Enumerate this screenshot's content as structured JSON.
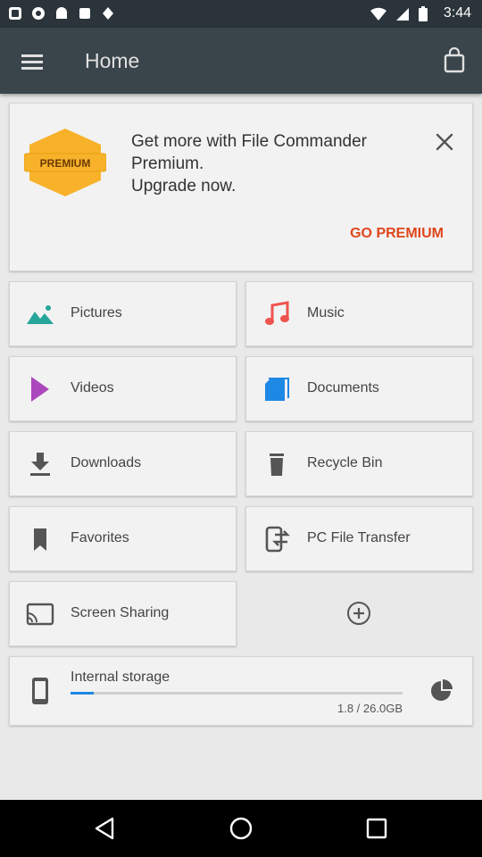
{
  "status_bar": {
    "time": "3:44"
  },
  "app_bar": {
    "title": "Home",
    "menu_icon": "hamburger-menu-icon",
    "shop_icon": "shopping-bag-icon"
  },
  "promo": {
    "badge_text": "PREMIUM",
    "lines": [
      "Get more with File Commander",
      "Premium.",
      "Upgrade now."
    ],
    "action_label": "GO PREMIUM"
  },
  "tiles": [
    {
      "label": "Pictures",
      "icon": "pictures-icon",
      "color": "#26a69a"
    },
    {
      "label": "Music",
      "icon": "music-note-icon",
      "color": "#ef5350"
    },
    {
      "label": "Videos",
      "icon": "play-icon",
      "color": "#ab47bc"
    },
    {
      "label": "Documents",
      "icon": "documents-icon",
      "color": "#1e88e5"
    },
    {
      "label": "Downloads",
      "icon": "download-icon",
      "color": "#555555"
    },
    {
      "label": "Recycle Bin",
      "icon": "trash-icon",
      "color": "#555555"
    },
    {
      "label": "Favorites",
      "icon": "bookmark-icon",
      "color": "#555555"
    },
    {
      "label": "PC File Transfer",
      "icon": "pc-transfer-icon",
      "color": "#555555"
    },
    {
      "label": "Screen Sharing",
      "icon": "screen-cast-icon",
      "color": "#555555"
    }
  ],
  "storage": {
    "name": "Internal storage",
    "size_text": "1.8 / 26.0GB",
    "used_fraction": 0.069
  },
  "colors": {
    "app_bar": "#3a454b",
    "accent": "#e0461c",
    "progress": "#1e88e5"
  }
}
